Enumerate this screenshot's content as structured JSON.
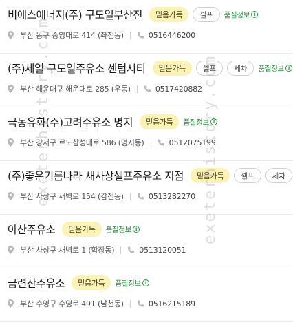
{
  "stations": [
    {
      "name": "비에스에너지(주) 구도일부산진",
      "trust": "믿음가득",
      "tags": [
        "셀프"
      ],
      "quality": "품질정보",
      "address": "부산 동구 중앙대로 414 (좌천동)",
      "phone": "0516446200"
    },
    {
      "name": "(주)세일 구도일주유소 센텀시티",
      "trust": "믿음가득",
      "tags": [
        "셀프",
        "세차"
      ],
      "quality": "품질정보",
      "address": "부산 해운대구 해운대로 285 (우동)",
      "phone": "0517420882"
    },
    {
      "name": "극동유화(주)고려주유소 명지",
      "trust": "믿음가득",
      "tags": [],
      "quality": "품질정보",
      "address": "부산 강서구 르노삼성대로 586 (명지동)",
      "phone": "0512075199"
    },
    {
      "name": "(주)좋은기름나라 새사상셀프주유소 지점",
      "trust": "믿음가득",
      "tags": [
        "셀프",
        "세차"
      ],
      "quality": "",
      "address": "부산 사상구 새벽로 154 (감전동)",
      "phone": "0513282270"
    },
    {
      "name": "아산주유소",
      "trust": "믿음가득",
      "tags": [],
      "quality": "품질정보",
      "address": "부산 사상구 새벽로 1 (학장동)",
      "phone": "0513120051"
    },
    {
      "name": "금련산주유소",
      "trust": "믿음가득",
      "tags": [],
      "quality": "품질정보",
      "address": "부산 수영구 수영로 491 (남천동)",
      "phone": "0516215189"
    }
  ],
  "watermark": "exeterhistory.com"
}
